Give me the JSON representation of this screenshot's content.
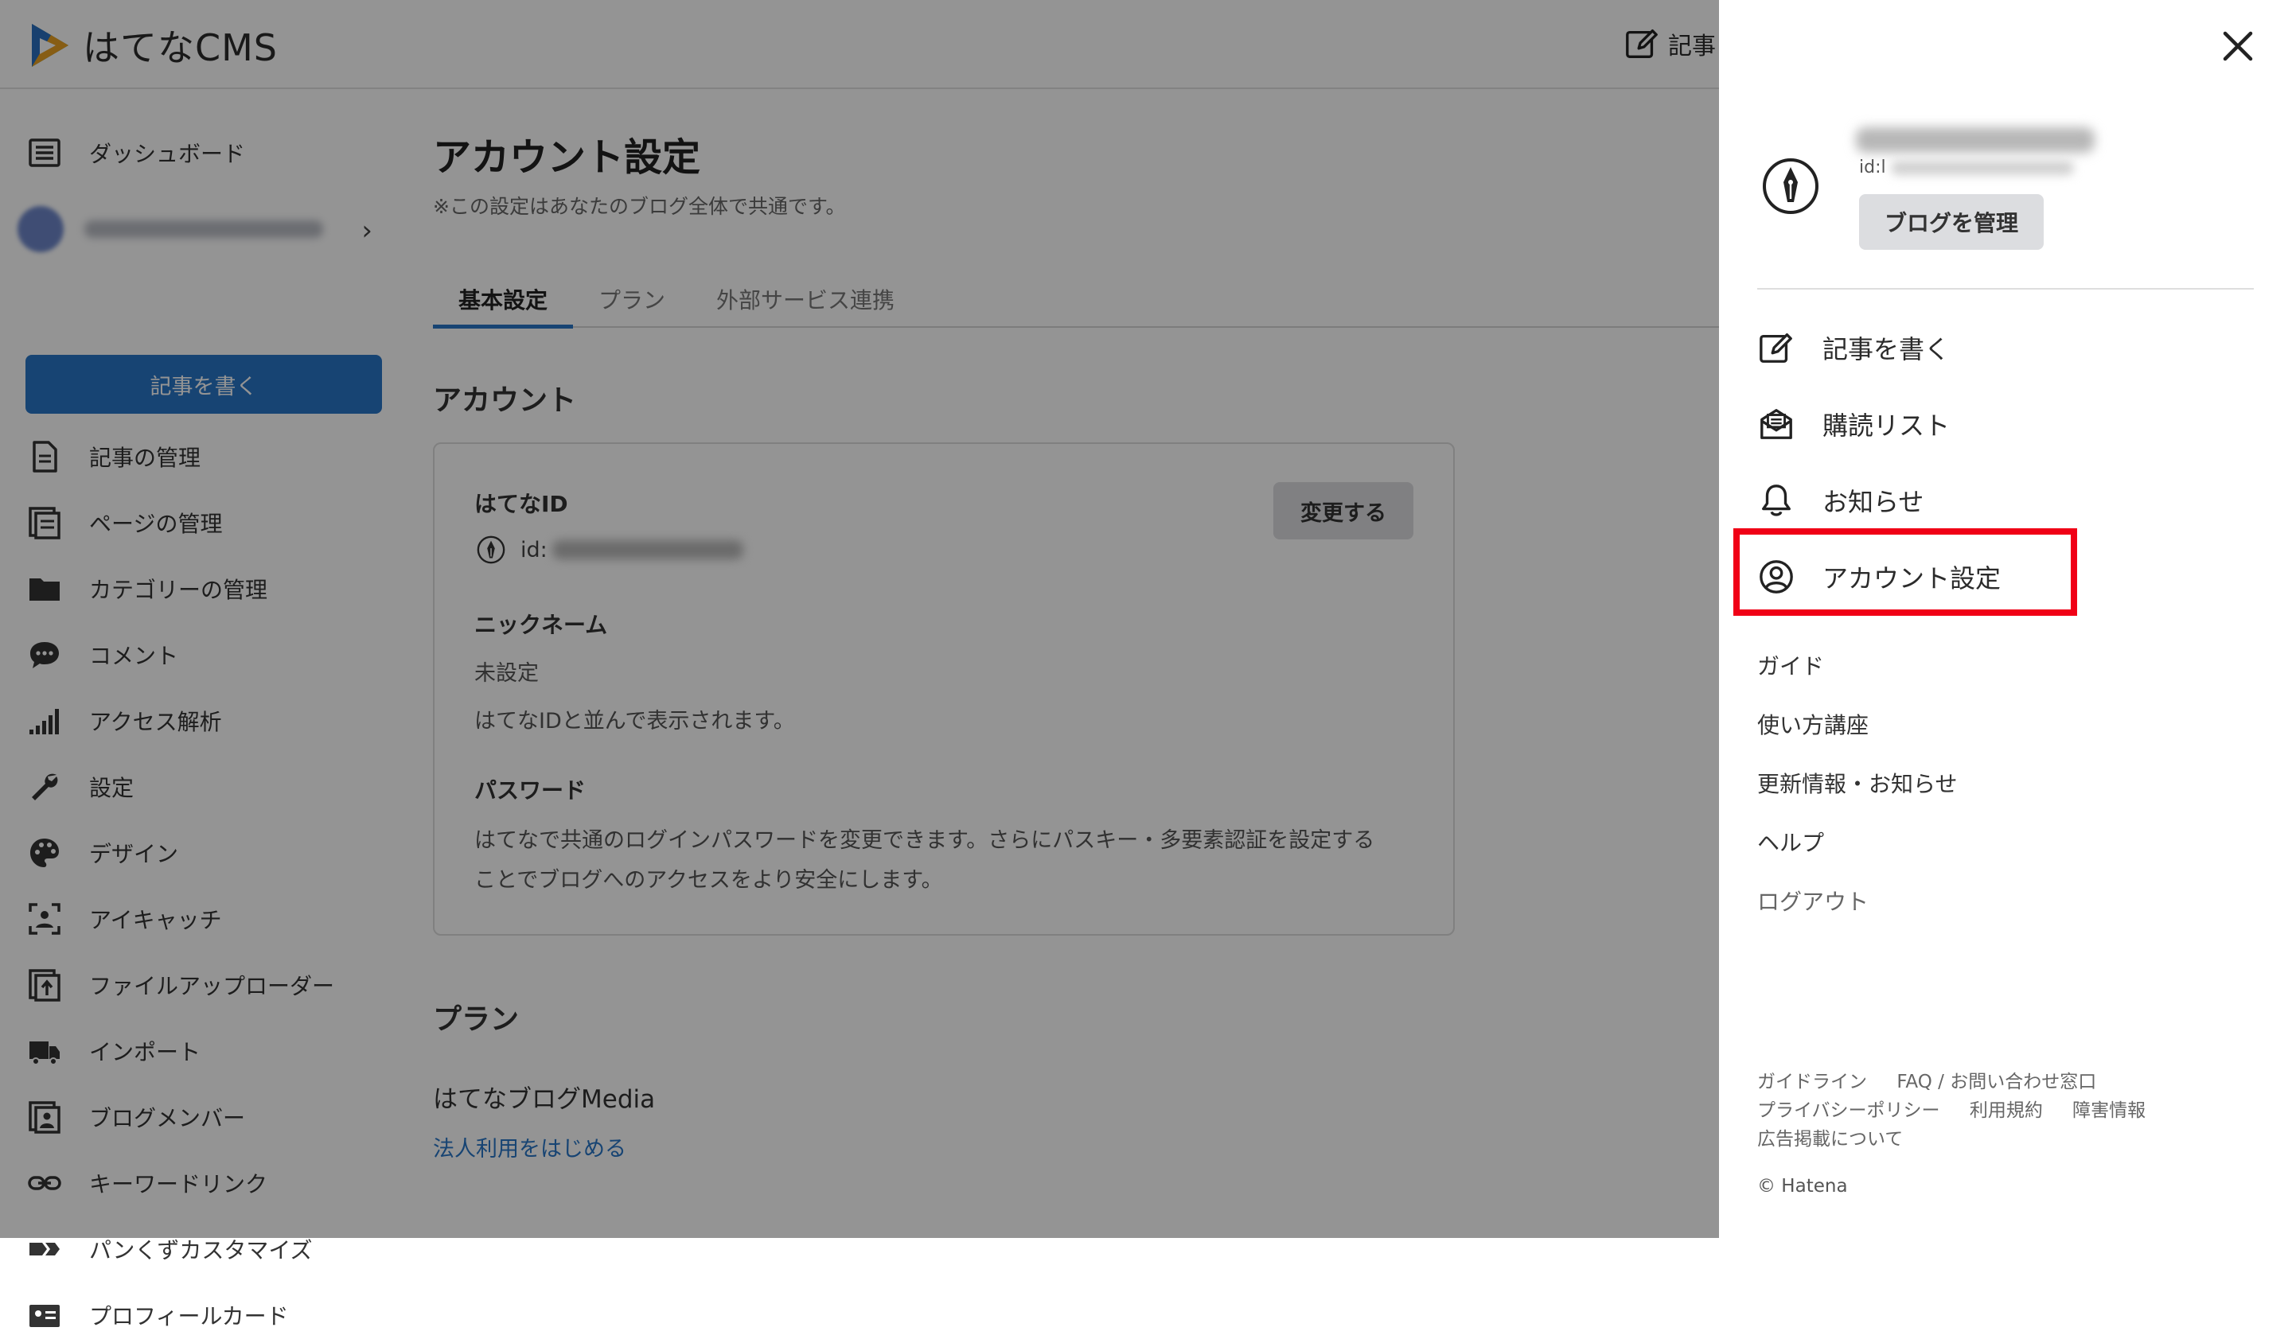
{
  "app": {
    "logo_text": "はてなCMS"
  },
  "topbar": {
    "write_label": "記事"
  },
  "sidebar": {
    "write_button": "記事を書く",
    "items": [
      {
        "label": "ダッシュボード",
        "icon": "dashboard-icon"
      },
      {
        "label": "記事の管理",
        "icon": "document-icon"
      },
      {
        "label": "ページの管理",
        "icon": "pages-icon"
      },
      {
        "label": "カテゴリーの管理",
        "icon": "folder-icon"
      },
      {
        "label": "コメント",
        "icon": "comment-icon"
      },
      {
        "label": "アクセス解析",
        "icon": "analytics-icon"
      },
      {
        "label": "設定",
        "icon": "wrench-icon"
      },
      {
        "label": "デザイン",
        "icon": "palette-icon"
      },
      {
        "label": "アイキャッチ",
        "icon": "eyecatch-icon"
      },
      {
        "label": "ファイルアップローダー",
        "icon": "upload-icon"
      },
      {
        "label": "インポート",
        "icon": "truck-icon"
      },
      {
        "label": "ブログメンバー",
        "icon": "member-icon"
      },
      {
        "label": "キーワードリンク",
        "icon": "link-icon"
      },
      {
        "label": "パンくずカスタマイズ",
        "icon": "breadcrumb-icon"
      },
      {
        "label": "プロフィールカード",
        "icon": "profile-card-icon"
      }
    ]
  },
  "main": {
    "title": "アカウント設定",
    "note": "※この設定はあなたのブログ全体で共通です。",
    "tabs": [
      {
        "label": "基本設定",
        "active": true
      },
      {
        "label": "プラン",
        "active": false
      },
      {
        "label": "外部サービス連携",
        "active": false
      }
    ],
    "account_section": "アカウント",
    "hatena_id_label": "はてなID",
    "id_prefix": "id:",
    "change_button": "変更する",
    "nickname_label": "ニックネーム",
    "nickname_value": "未設定",
    "nickname_note": "はてなIDと並んで表示されます。",
    "password_label": "パスワード",
    "password_desc_1": "はてなで共通のログインパスワードを変更できます。さらにパスキー・多要素認証を設定する",
    "password_desc_2": "ことでブログへのアクセスをより安全にします。",
    "plan_section": "プラン",
    "plan_name": "はてなブログMedia",
    "plan_link": "法人利用をはじめる"
  },
  "drawer": {
    "user_id_prefix": "id:l",
    "manage_button": "ブログを管理",
    "menu": [
      {
        "label": "記事を書く",
        "icon": "edit-icon"
      },
      {
        "label": "購読リスト",
        "icon": "subscription-icon"
      },
      {
        "label": "お知らせ",
        "icon": "bell-icon"
      },
      {
        "label": "アカウント設定",
        "icon": "account-icon",
        "highlighted": true
      }
    ],
    "links": [
      "ガイド",
      "使い方講座",
      "更新情報・お知らせ",
      "ヘルプ"
    ],
    "logout": "ログアウト",
    "footer": {
      "row1": [
        "ガイドライン",
        "FAQ / お問い合わせ窓口"
      ],
      "row2": [
        "プライバシーポリシー",
        "利用規約",
        "障害情報"
      ],
      "row3": [
        "広告掲載について"
      ]
    },
    "copyright": "© Hatena"
  },
  "colors": {
    "accent": "#2875c6",
    "highlight": "#f00016",
    "overlay": "rgba(0,0,0,0.42)"
  }
}
